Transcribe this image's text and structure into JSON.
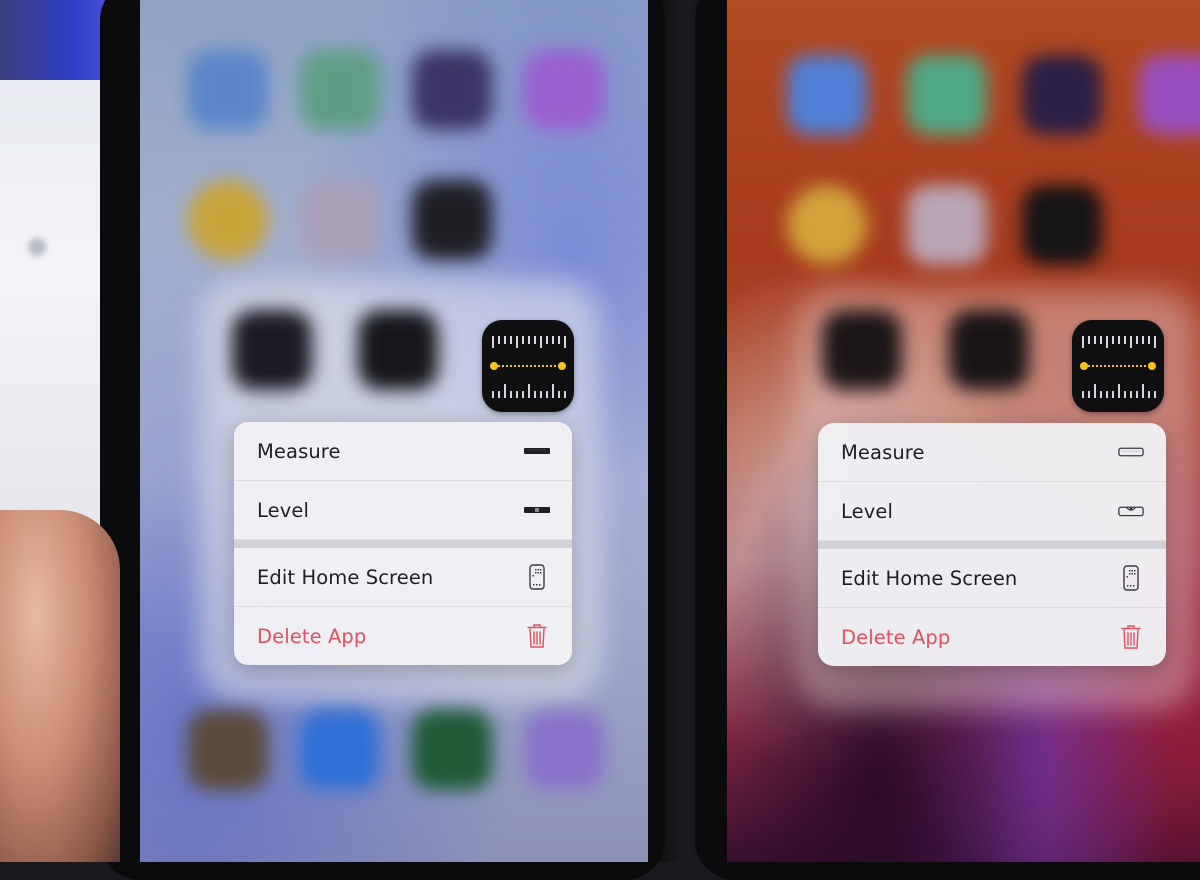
{
  "scene": {
    "description": "Two iPhones side-by-side showing the Measure app quick-action menu"
  },
  "colors": {
    "destructive": "#e0505e",
    "menu_text": "#1f1f23",
    "menu_bg": "#f0f0f5",
    "measure_icon_bg": "#101012",
    "measure_icon_accent": "#f5c518"
  },
  "phones": [
    {
      "side": "left",
      "app_icon": {
        "name": "Measure",
        "icon": "measure-ruler-icon"
      },
      "menu": {
        "items": [
          {
            "label": "Measure",
            "icon": "ruler-filled-icon",
            "destructive": false
          },
          {
            "label": "Level",
            "icon": "level-filled-icon",
            "destructive": false
          },
          {
            "label": "Edit Home Screen",
            "icon": "phone-apps-icon",
            "destructive": false
          },
          {
            "label": "Delete App",
            "icon": "trash-icon",
            "destructive": true
          }
        ]
      }
    },
    {
      "side": "right",
      "app_icon": {
        "name": "Measure",
        "icon": "measure-ruler-icon"
      },
      "menu": {
        "items": [
          {
            "label": "Measure",
            "icon": "ruler-outline-icon",
            "destructive": false
          },
          {
            "label": "Level",
            "icon": "level-outline-icon",
            "destructive": false
          },
          {
            "label": "Edit Home Screen",
            "icon": "phone-apps-icon",
            "destructive": false
          },
          {
            "label": "Delete App",
            "icon": "trash-icon",
            "destructive": true
          }
        ]
      }
    }
  ]
}
